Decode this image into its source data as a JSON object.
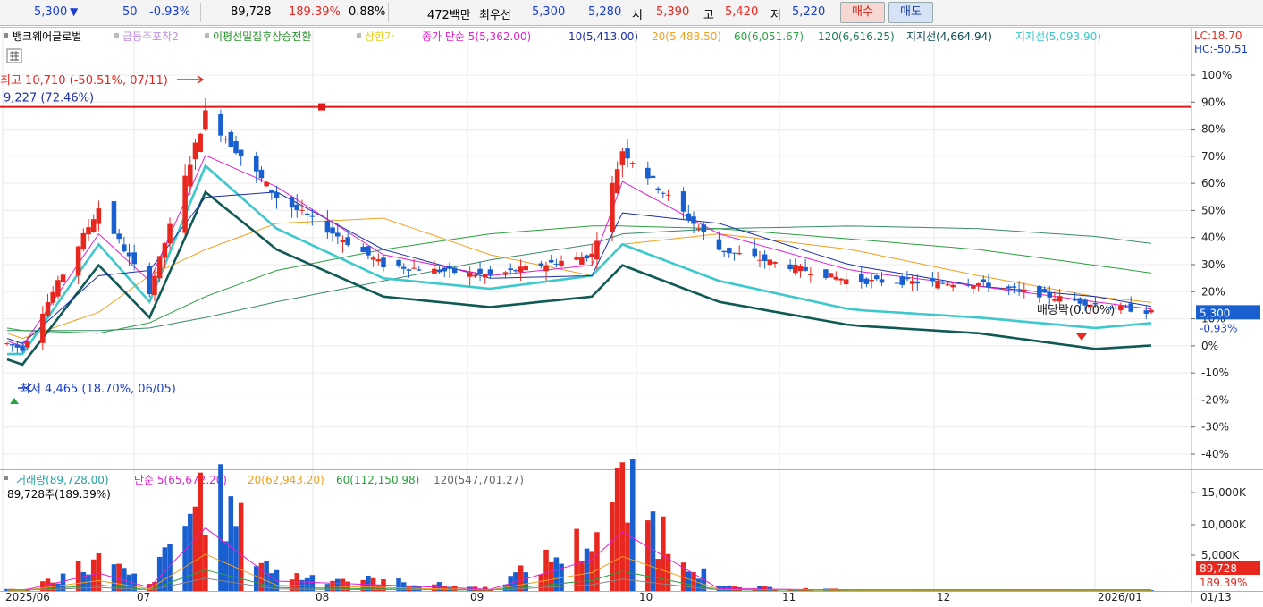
{
  "topbar": {
    "price": "5,300",
    "change_arrow": "▼",
    "change": "50",
    "change_pct": "-0.93%",
    "volume": "89,728",
    "volume_ratio": "189.39%",
    "turnover": "0.88%",
    "trade_value": "472백만",
    "best_label": "최우선",
    "best_ask": "5,300",
    "best_bid": "5,280",
    "open_label": "시",
    "open": "5,390",
    "high_label": "고",
    "high": "5,420",
    "low_label": "저",
    "low": "5,220",
    "buy_label": "매수",
    "sell_label": "매도"
  },
  "legend": {
    "stock": "뱅크웨어글로벌",
    "ind1": "급등주포착2",
    "ind2": "이평선밀집후상승전환",
    "ind3": "상한가",
    "close_ma": "종가 단순 5(5,362.00)",
    "ma10": "10(5,413.00)",
    "ma20": "20(5,488.50)",
    "ma60": "60(6,051.67)",
    "ma120": "120(6,616.25)",
    "support1": "지지선(4,664.94)",
    "support2": "지지선(5,093.90)",
    "lc": "LC:18.70",
    "hc": "HC:-50.51"
  },
  "vol_legend": {
    "vol": "거래량(89,728.00)",
    "ma5": "단순 5(65,672.20)",
    "ma20": "20(62,943.20)",
    "ma60": "60(112,150.98)",
    "ma120": "120(547,701.27)",
    "last": "89,728주(189.39%)"
  },
  "annotations": {
    "high": "최고 10,710 (-50.51%, 07/11)",
    "low": "최저 4,465 (18.70%, 06/05)",
    "hline": "9,227 (72.46%)",
    "dividend": "배당락(0.00%)"
  },
  "badges": {
    "price": "5,300",
    "pct": "-0.93%",
    "vol": "89,728",
    "vol_pct": "189.39%"
  },
  "colors": {
    "up": "#e8271f",
    "down": "#1a5fd0",
    "ma5": "#e020d0",
    "ma10": "#1a2ea8",
    "ma20": "#f0a020",
    "ma60": "#2aa040",
    "ma120": "#3a8a6a",
    "support1": "#0f5a55",
    "support2": "#3cc8cc",
    "hline": "#e01818"
  },
  "chart_data": {
    "type": "candlestick",
    "y_axis_pct_ticks": [
      "100%",
      "90%",
      "80%",
      "70%",
      "60%",
      "50%",
      "40%",
      "30%",
      "20%",
      "10%",
      "0%",
      "-10%",
      "-20%",
      "-30%",
      "-40%"
    ],
    "vol_axis_ticks": [
      "15,000K",
      "10,000K",
      "5,000K"
    ],
    "x_ticks": [
      "2025/06",
      "07",
      "08",
      "09",
      "10",
      "11",
      "12",
      "2026/01",
      "01/13"
    ],
    "hline_value": 9227,
    "vol_ma_latest": {
      "ma5": 65672.2,
      "ma20": 62943.2,
      "ma60": 112150.98,
      "ma120": 547701.27
    },
    "price_ma_latest": {
      "ma5": 5362.0,
      "ma10": 5413.0,
      "ma20": 5488.5,
      "ma60": 6051.67,
      "ma120": 6616.25
    },
    "support_latest": {
      "support1": 4664.94,
      "support2": 5093.9
    },
    "keypoints": {
      "dates": [
        "2025-06-02",
        "2025-06-05",
        "2025-06-20",
        "2025-06-30",
        "2025-07-11",
        "2025-07-25",
        "2025-08-15",
        "2025-09-05",
        "2025-09-25",
        "2025-10-01",
        "2025-10-20",
        "2025-11-15",
        "2025-12-10",
        "2026-01-02",
        "2026-01-13"
      ],
      "close": [
        4700,
        4600,
        7300,
        5700,
        9100,
        7500,
        6200,
        6000,
        6400,
        8400,
        6500,
        5900,
        5850,
        5450,
        5300
      ],
      "ma5": [
        4750,
        4650,
        6800,
        5900,
        8300,
        7700,
        6400,
        6000,
        6200,
        7800,
        6800,
        6100,
        5800,
        5500,
        5362
      ],
      "ma10": [
        4800,
        4700,
        6000,
        6100,
        7500,
        7600,
        6500,
        5950,
        6000,
        7200,
        7000,
        6200,
        5800,
        5600,
        5413
      ],
      "ma20": [
        4900,
        4800,
        5300,
        6000,
        6500,
        7000,
        7100,
        6400,
        6000,
        6600,
        6800,
        6500,
        6000,
        5600,
        5488.5
      ],
      "ma60": [
        5000,
        4950,
        4900,
        5100,
        5600,
        6100,
        6500,
        6800,
        6950,
        6950,
        6900,
        6700,
        6500,
        6200,
        6051.67
      ],
      "ma120": [
        4950,
        4950,
        4950,
        5000,
        5200,
        5500,
        5900,
        6300,
        6600,
        6800,
        6900,
        6950,
        6900,
        6750,
        6616.25
      ],
      "support1": [
        4400,
        4300,
        6200,
        5200,
        7600,
        6500,
        5600,
        5400,
        5600,
        6200,
        5500,
        5050,
        4900,
        4600,
        4664.94
      ],
      "support2": [
        4500,
        4500,
        6600,
        5500,
        8100,
        6900,
        5950,
        5750,
        6000,
        6600,
        5900,
        5350,
        5200,
        5000,
        5093.9
      ],
      "volume_k": [
        300,
        120,
        4500,
        900,
        16000,
        2500,
        1500,
        400,
        8000,
        15000,
        600,
        200,
        150,
        90,
        89.728
      ]
    }
  }
}
